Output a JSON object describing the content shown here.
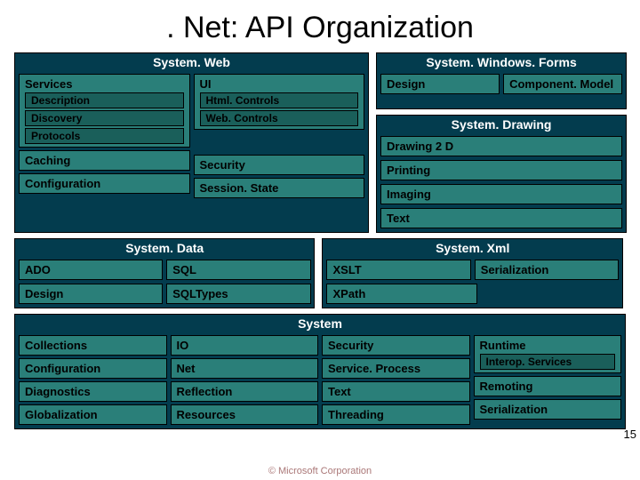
{
  "title": ". Net: API Organization",
  "panels": {
    "systemWeb": {
      "title": "System. Web",
      "left": {
        "services": "Services",
        "description": "Description",
        "discovery": "Discovery",
        "protocols": "Protocols",
        "caching": "Caching",
        "configuration": "Configuration"
      },
      "right": {
        "ui": "UI",
        "htmlControls": "Html. Controls",
        "webControls": "Web. Controls",
        "security": "Security",
        "sessionState": "Session. State"
      }
    },
    "systemWindowsForms": {
      "title": "System. Windows. Forms",
      "design": "Design",
      "componentModel": "Component. Model"
    },
    "systemDrawing": {
      "title": "System. Drawing",
      "drawing2d": "Drawing 2 D",
      "printing": "Printing",
      "imaging": "Imaging",
      "text": "Text"
    },
    "systemData": {
      "title": "System. Data",
      "ado": "ADO",
      "sql": "SQL",
      "design": "Design",
      "sqlTypes": "SQLTypes"
    },
    "systemXml": {
      "title": "System. Xml",
      "xslt": "XSLT",
      "serialization": "Serialization",
      "xpath": "XPath"
    },
    "system": {
      "title": "System",
      "col1": {
        "collections": "Collections",
        "configuration": "Configuration",
        "diagnostics": "Diagnostics",
        "globalization": "Globalization"
      },
      "col2": {
        "io": "IO",
        "net": "Net",
        "reflection": "Reflection",
        "resources": "Resources"
      },
      "col3": {
        "security": "Security",
        "serviceProcess": "Service. Process",
        "text": "Text",
        "threading": "Threading"
      },
      "col4": {
        "runtime": "Runtime",
        "interopServices": "Interop. Services",
        "remoting": "Remoting",
        "serialization": "Serialization"
      }
    }
  },
  "copyright": "© Microsoft Corporation",
  "pageNumber": "15"
}
